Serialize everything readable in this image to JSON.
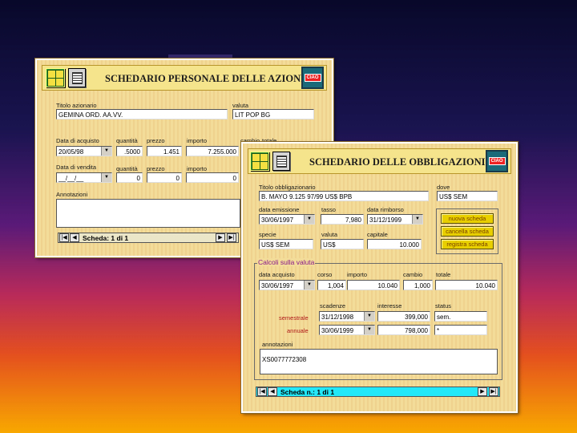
{
  "azioni": {
    "title": "SCHEDARIO PERSONALE DELLE AZIONI",
    "titolo_label": "Titolo azionario",
    "titolo_value": "GEMINA ORD.   AA.VV.",
    "valuta_label": "valuta",
    "valuta_value": "LIT POP BG",
    "acquisto_label": "Data di acquisto",
    "quantita_label": "quantità",
    "prezzo_label": "prezzo",
    "importo_label": "importo",
    "cambio_label": "cambio",
    "totale_label": "totale",
    "acquisto_date": "20/05/98",
    "acquisto_qty": ".5000",
    "acquisto_prezzo": "1.451",
    "acquisto_importo": "7.255.000",
    "vendita_label": "Data di vendita",
    "vendita_date": "__/__/__",
    "vendita_qty": "0",
    "vendita_prezzo": "0",
    "vendita_importo": "0",
    "annotazioni_label": "Annotazioni",
    "annotazioni_value": "",
    "nav_text": "Scheda: 1 di  1"
  },
  "obbligazioni": {
    "title": "SCHEDARIO DELLE OBBLIGAZIONI",
    "titolo_label": "Titolo obbligazionario",
    "titolo_value": "B. MAYO 9.125 97/99  US$ BPB",
    "dove_label": "dove",
    "dove_value": "US$ SEM",
    "emissione_label": "data emissione",
    "emissione_value": "30/06/1997",
    "tasso_label": "tasso",
    "tasso_value": "7,980",
    "rimborso_label": "data rimborso",
    "rimborso_value": "31/12/1999",
    "specie_label": "specie",
    "specie_value": "US$ SEM",
    "valuta_label": "valuta",
    "valuta_value": "US$",
    "capitale_label": "capitale",
    "capitale_value": "10.000",
    "btn_nuova": "nuova scheda",
    "btn_cancella": "cancella scheda",
    "btn_registra": "registra scheda",
    "calcoli_legend": "Calcoli sulla valuta",
    "c_acquisto_label": "data acquisto",
    "c_corso_label": "corso",
    "c_importo_label": "importo",
    "c_cambio_label": "cambio",
    "c_totale_label": "totale",
    "c_acquisto_value": "30/06/1997",
    "c_corso_value": "1,004",
    "c_importo_value": "10.040",
    "c_cambio_value": "1,000",
    "c_totale_value": "10.040",
    "scadenze_label": "scadenze",
    "interesse_label": "interesse",
    "status_label": "status",
    "semestrale_label": "semestrale",
    "sem_date": "31/12/1998",
    "sem_interesse": "399,000",
    "sem_status": "sem.",
    "annuale_label": "annuale",
    "ann_date": "30/06/1999",
    "ann_interesse": "798,000",
    "ann_status": "*",
    "annotazioni_label": "annotazioni",
    "annotazioni_value": "XS0077772308",
    "nav_text": "Scheda n.: 1 di  1"
  },
  "icons": [
    "grid-icon",
    "notebook-icon",
    "ciao-exit-icon",
    "first-record-icon",
    "prev-record-icon",
    "next-record-icon",
    "last-record-icon",
    "dropdown-arrow-icon"
  ],
  "colors": {
    "panel": "#f3dc9a",
    "button": "#e8d000",
    "nav_cyan": "#22e8f8",
    "label_red": "#b01818",
    "legend_purple": "#8a1a8a"
  },
  "ciao_label": "CIAO"
}
